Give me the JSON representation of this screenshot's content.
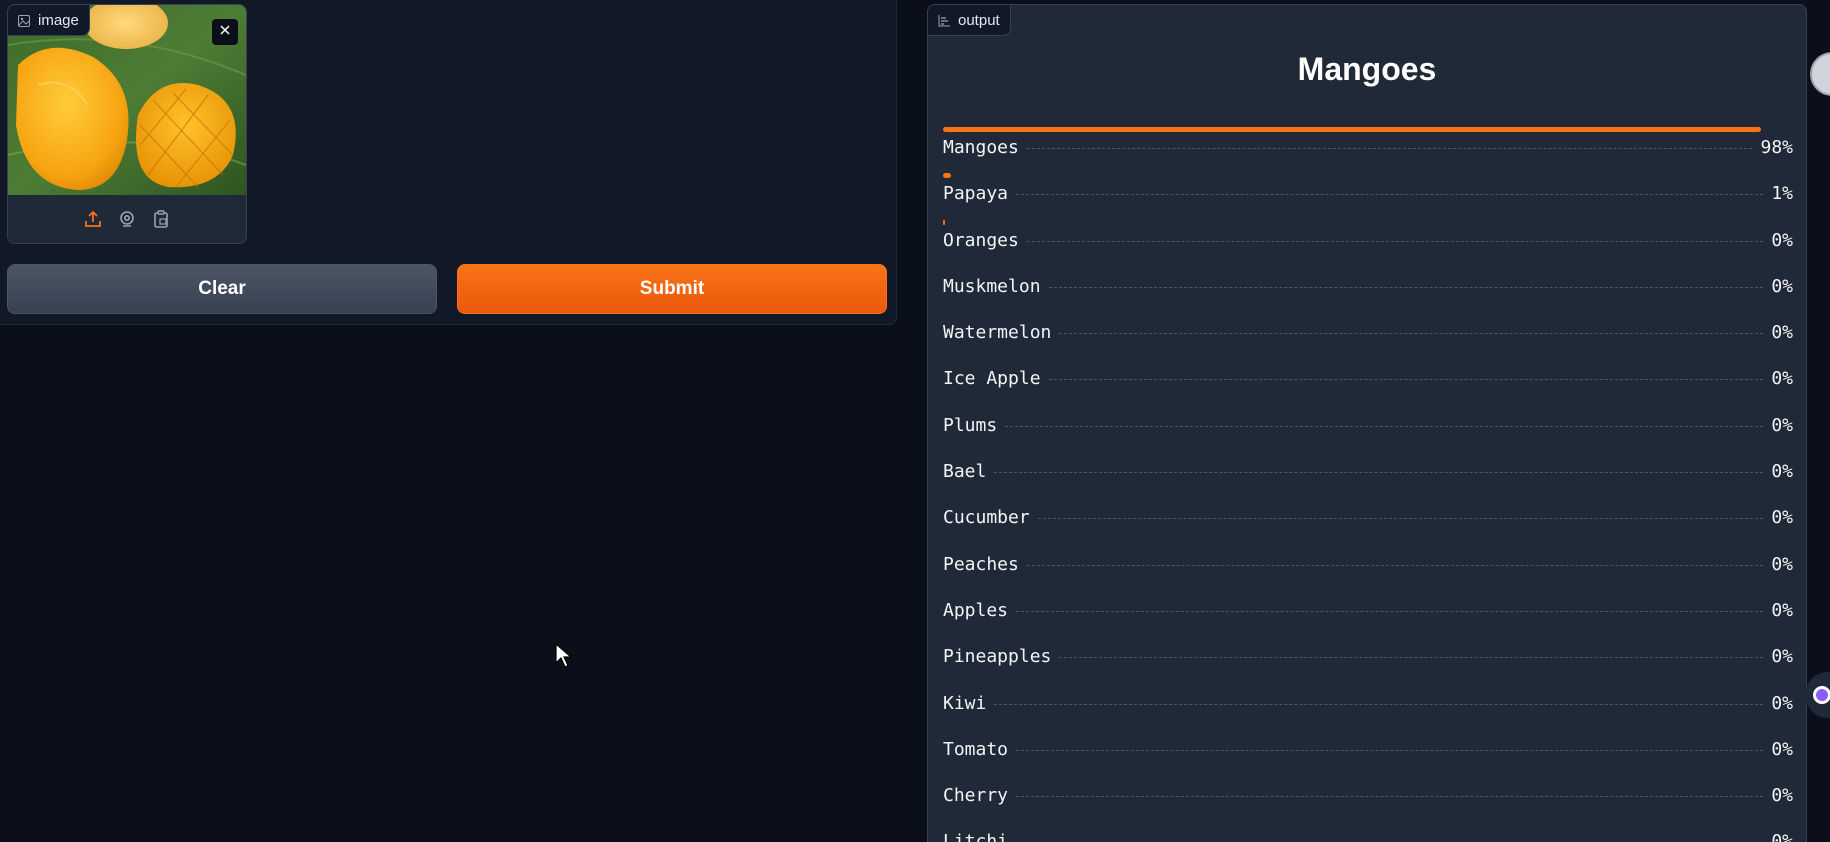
{
  "input": {
    "label": "image",
    "label_icon": "image-icon",
    "close_icon": "close-icon",
    "sources": [
      "upload-icon",
      "webcam-icon",
      "clipboard-icon"
    ]
  },
  "buttons": {
    "clear_label": "Clear",
    "submit_label": "Submit"
  },
  "output": {
    "label": "output",
    "label_icon": "bar-chart-icon",
    "top_label": "Mangoes",
    "confidences": [
      {
        "label": "Mangoes",
        "display": "98%",
        "value": 0.98
      },
      {
        "label": "Papaya",
        "display": "1%",
        "value": 0.01
      },
      {
        "label": "Oranges",
        "display": "0%",
        "value": 0.002
      },
      {
        "label": "Muskmelon",
        "display": "0%",
        "value": 0
      },
      {
        "label": "Watermelon",
        "display": "0%",
        "value": 0
      },
      {
        "label": "Ice Apple",
        "display": "0%",
        "value": 0
      },
      {
        "label": "Plums",
        "display": "0%",
        "value": 0
      },
      {
        "label": "Bael",
        "display": "0%",
        "value": 0
      },
      {
        "label": "Cucumber",
        "display": "0%",
        "value": 0
      },
      {
        "label": "Peaches",
        "display": "0%",
        "value": 0
      },
      {
        "label": "Apples",
        "display": "0%",
        "value": 0
      },
      {
        "label": "Pineapples",
        "display": "0%",
        "value": 0
      },
      {
        "label": "Kiwi",
        "display": "0%",
        "value": 0
      },
      {
        "label": "Tomato",
        "display": "0%",
        "value": 0
      },
      {
        "label": "Cherry",
        "display": "0%",
        "value": 0
      },
      {
        "label": "Litchi",
        "display": "0%",
        "value": 0
      }
    ]
  },
  "colors": {
    "accent": "#f97316",
    "panel": "#1f2937",
    "background": "#0b0f19"
  }
}
